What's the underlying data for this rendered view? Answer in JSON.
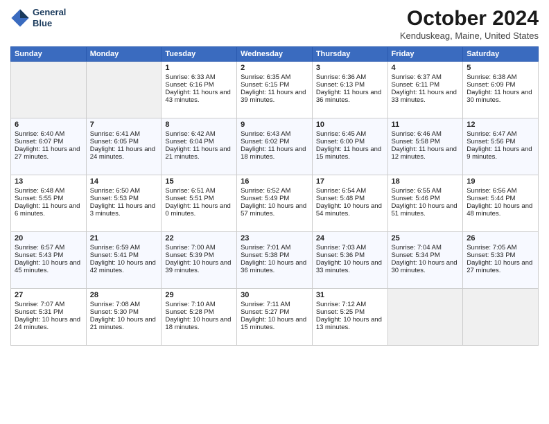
{
  "header": {
    "logo_line1": "General",
    "logo_line2": "Blue",
    "title": "October 2024",
    "subtitle": "Kenduskeag, Maine, United States"
  },
  "columns": [
    "Sunday",
    "Monday",
    "Tuesday",
    "Wednesday",
    "Thursday",
    "Friday",
    "Saturday"
  ],
  "weeks": [
    [
      {
        "day": "",
        "empty": true
      },
      {
        "day": "",
        "empty": true
      },
      {
        "day": "1",
        "sunrise": "Sunrise: 6:33 AM",
        "sunset": "Sunset: 6:16 PM",
        "daylight": "Daylight: 11 hours and 43 minutes."
      },
      {
        "day": "2",
        "sunrise": "Sunrise: 6:35 AM",
        "sunset": "Sunset: 6:15 PM",
        "daylight": "Daylight: 11 hours and 39 minutes."
      },
      {
        "day": "3",
        "sunrise": "Sunrise: 6:36 AM",
        "sunset": "Sunset: 6:13 PM",
        "daylight": "Daylight: 11 hours and 36 minutes."
      },
      {
        "day": "4",
        "sunrise": "Sunrise: 6:37 AM",
        "sunset": "Sunset: 6:11 PM",
        "daylight": "Daylight: 11 hours and 33 minutes."
      },
      {
        "day": "5",
        "sunrise": "Sunrise: 6:38 AM",
        "sunset": "Sunset: 6:09 PM",
        "daylight": "Daylight: 11 hours and 30 minutes."
      }
    ],
    [
      {
        "day": "6",
        "sunrise": "Sunrise: 6:40 AM",
        "sunset": "Sunset: 6:07 PM",
        "daylight": "Daylight: 11 hours and 27 minutes."
      },
      {
        "day": "7",
        "sunrise": "Sunrise: 6:41 AM",
        "sunset": "Sunset: 6:05 PM",
        "daylight": "Daylight: 11 hours and 24 minutes."
      },
      {
        "day": "8",
        "sunrise": "Sunrise: 6:42 AM",
        "sunset": "Sunset: 6:04 PM",
        "daylight": "Daylight: 11 hours and 21 minutes."
      },
      {
        "day": "9",
        "sunrise": "Sunrise: 6:43 AM",
        "sunset": "Sunset: 6:02 PM",
        "daylight": "Daylight: 11 hours and 18 minutes."
      },
      {
        "day": "10",
        "sunrise": "Sunrise: 6:45 AM",
        "sunset": "Sunset: 6:00 PM",
        "daylight": "Daylight: 11 hours and 15 minutes."
      },
      {
        "day": "11",
        "sunrise": "Sunrise: 6:46 AM",
        "sunset": "Sunset: 5:58 PM",
        "daylight": "Daylight: 11 hours and 12 minutes."
      },
      {
        "day": "12",
        "sunrise": "Sunrise: 6:47 AM",
        "sunset": "Sunset: 5:56 PM",
        "daylight": "Daylight: 11 hours and 9 minutes."
      }
    ],
    [
      {
        "day": "13",
        "sunrise": "Sunrise: 6:48 AM",
        "sunset": "Sunset: 5:55 PM",
        "daylight": "Daylight: 11 hours and 6 minutes."
      },
      {
        "day": "14",
        "sunrise": "Sunrise: 6:50 AM",
        "sunset": "Sunset: 5:53 PM",
        "daylight": "Daylight: 11 hours and 3 minutes."
      },
      {
        "day": "15",
        "sunrise": "Sunrise: 6:51 AM",
        "sunset": "Sunset: 5:51 PM",
        "daylight": "Daylight: 11 hours and 0 minutes."
      },
      {
        "day": "16",
        "sunrise": "Sunrise: 6:52 AM",
        "sunset": "Sunset: 5:49 PM",
        "daylight": "Daylight: 10 hours and 57 minutes."
      },
      {
        "day": "17",
        "sunrise": "Sunrise: 6:54 AM",
        "sunset": "Sunset: 5:48 PM",
        "daylight": "Daylight: 10 hours and 54 minutes."
      },
      {
        "day": "18",
        "sunrise": "Sunrise: 6:55 AM",
        "sunset": "Sunset: 5:46 PM",
        "daylight": "Daylight: 10 hours and 51 minutes."
      },
      {
        "day": "19",
        "sunrise": "Sunrise: 6:56 AM",
        "sunset": "Sunset: 5:44 PM",
        "daylight": "Daylight: 10 hours and 48 minutes."
      }
    ],
    [
      {
        "day": "20",
        "sunrise": "Sunrise: 6:57 AM",
        "sunset": "Sunset: 5:43 PM",
        "daylight": "Daylight: 10 hours and 45 minutes."
      },
      {
        "day": "21",
        "sunrise": "Sunrise: 6:59 AM",
        "sunset": "Sunset: 5:41 PM",
        "daylight": "Daylight: 10 hours and 42 minutes."
      },
      {
        "day": "22",
        "sunrise": "Sunrise: 7:00 AM",
        "sunset": "Sunset: 5:39 PM",
        "daylight": "Daylight: 10 hours and 39 minutes."
      },
      {
        "day": "23",
        "sunrise": "Sunrise: 7:01 AM",
        "sunset": "Sunset: 5:38 PM",
        "daylight": "Daylight: 10 hours and 36 minutes."
      },
      {
        "day": "24",
        "sunrise": "Sunrise: 7:03 AM",
        "sunset": "Sunset: 5:36 PM",
        "daylight": "Daylight: 10 hours and 33 minutes."
      },
      {
        "day": "25",
        "sunrise": "Sunrise: 7:04 AM",
        "sunset": "Sunset: 5:34 PM",
        "daylight": "Daylight: 10 hours and 30 minutes."
      },
      {
        "day": "26",
        "sunrise": "Sunrise: 7:05 AM",
        "sunset": "Sunset: 5:33 PM",
        "daylight": "Daylight: 10 hours and 27 minutes."
      }
    ],
    [
      {
        "day": "27",
        "sunrise": "Sunrise: 7:07 AM",
        "sunset": "Sunset: 5:31 PM",
        "daylight": "Daylight: 10 hours and 24 minutes."
      },
      {
        "day": "28",
        "sunrise": "Sunrise: 7:08 AM",
        "sunset": "Sunset: 5:30 PM",
        "daylight": "Daylight: 10 hours and 21 minutes."
      },
      {
        "day": "29",
        "sunrise": "Sunrise: 7:10 AM",
        "sunset": "Sunset: 5:28 PM",
        "daylight": "Daylight: 10 hours and 18 minutes."
      },
      {
        "day": "30",
        "sunrise": "Sunrise: 7:11 AM",
        "sunset": "Sunset: 5:27 PM",
        "daylight": "Daylight: 10 hours and 15 minutes."
      },
      {
        "day": "31",
        "sunrise": "Sunrise: 7:12 AM",
        "sunset": "Sunset: 5:25 PM",
        "daylight": "Daylight: 10 hours and 13 minutes."
      },
      {
        "day": "",
        "empty": true
      },
      {
        "day": "",
        "empty": true
      }
    ]
  ]
}
